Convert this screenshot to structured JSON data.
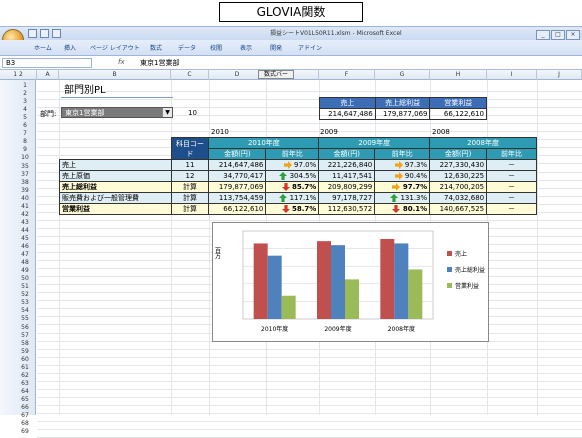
{
  "banner": "GLOVIA関数",
  "window_title": "損益シートV01L50R11.xlsm - Microsoft Excel",
  "ribbon_tabs": [
    "ホーム",
    "挿入",
    "ページ レイアウト",
    "数式",
    "データ",
    "校閲",
    "表示",
    "開発",
    "アドイン"
  ],
  "name_box": "B3",
  "formula": "東京1営業部",
  "formula_button": "数式バー",
  "columns": [
    "A",
    "B",
    "C",
    "D",
    "E",
    "F",
    "G",
    "H",
    "I",
    "J"
  ],
  "rows": [
    "1",
    "2",
    "3",
    "4",
    "5",
    "6",
    "7",
    "8",
    "9",
    "10",
    "35",
    "37",
    "38",
    "39",
    "40",
    "41",
    "42",
    "43",
    "44",
    "45",
    "46",
    "47",
    "48",
    "49",
    "50",
    "51",
    "52",
    "53",
    "54",
    "55",
    "56",
    "57",
    "58",
    "59",
    "60",
    "61",
    "62",
    "63",
    "64",
    "65",
    "66",
    "67",
    "68",
    "69"
  ],
  "page_title": "部門別PL",
  "dept_label": "部門:",
  "dept_value": "東京1営業部",
  "dept_code": "10",
  "kpi": {
    "headers": [
      "売上",
      "売上総利益",
      "営業利益"
    ],
    "values": [
      "214,647,486",
      "179,877,069",
      "66,122,610"
    ]
  },
  "year_labels": [
    "2010",
    "2009",
    "2008"
  ],
  "table": {
    "code_header": "科目コード",
    "years": [
      "2010年度",
      "2009年度",
      "2008年度"
    ],
    "subheaders": [
      "金額(円)",
      "前年比"
    ],
    "rows": [
      {
        "name": "売上",
        "code": "11",
        "y2010": "214,647,486",
        "r2010": "97.0%",
        "a2010": "right",
        "y2009": "221,226,840",
        "r2009": "97.3%",
        "a2009": "right",
        "y2008": "227,330,430",
        "r2008": "－"
      },
      {
        "name": "売上原価",
        "code": "12",
        "y2010": "34,770,417",
        "r2010": "304.5%",
        "a2010": "up",
        "y2009": "11,417,541",
        "r2009": "90.4%",
        "a2009": "right",
        "y2008": "12,630,225",
        "r2008": "－"
      },
      {
        "name": "売上総利益",
        "code": "計算",
        "y2010": "179,877,069",
        "r2010": "85.7%",
        "a2010": "down",
        "y2009": "209,809,299",
        "r2009": "97.7%",
        "a2009": "right",
        "y2008": "214,700,205",
        "r2008": "－"
      },
      {
        "name": "販売費および一般管理費",
        "code": "計算",
        "y2010": "113,754,459",
        "r2010": "117.1%",
        "a2010": "up",
        "y2009": "97,178,727",
        "r2009": "131.3%",
        "a2009": "up",
        "y2008": "74,032,680",
        "r2008": "－"
      },
      {
        "name": "営業利益",
        "code": "計算",
        "y2010": "66,122,610",
        "r2010": "58.7%",
        "a2010": "down",
        "y2009": "112,630,572",
        "r2009": "80.1%",
        "a2009": "down",
        "y2008": "140,667,525",
        "r2008": "－"
      }
    ]
  },
  "chart_data": {
    "type": "bar",
    "ylabel": "百万",
    "categories": [
      "2010年度",
      "2009年度",
      "2008年度"
    ],
    "series": [
      {
        "name": "売上",
        "values": [
          214.6,
          221.2,
          227.3
        ],
        "color": "#c0504d"
      },
      {
        "name": "売上総利益",
        "values": [
          179.9,
          209.8,
          214.7
        ],
        "color": "#4f81bd"
      },
      {
        "name": "営業利益",
        "values": [
          66.1,
          112.6,
          140.7
        ],
        "color": "#9bbb59"
      }
    ],
    "ylim": [
      0,
      250
    ],
    "legend": "right"
  }
}
